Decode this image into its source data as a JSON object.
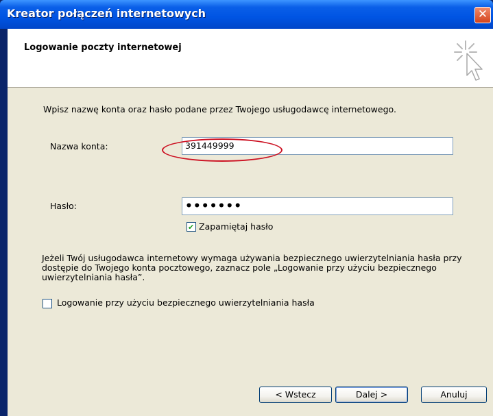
{
  "window": {
    "title": "Kreator połączeń internetowych",
    "close_glyph": "✕"
  },
  "header": {
    "title": "Logowanie poczty internetowej",
    "icon": "wizard-cursor-icon"
  },
  "form": {
    "intro": "Wpisz nazwę konta oraz hasło podane przez Twojego usługodawcę internetowego.",
    "account_label": "Nazwa konta:",
    "account_value": "391449999",
    "password_label": "Hasło:",
    "password_mask": "•••••••",
    "remember_label": "Zapamiętaj hasło",
    "remember_checked": true,
    "spa_paragraph": "Jeżeli Twój usługodawca internetowy wymaga używania bezpiecznego uwierzytelniania hasła przy dostępie do Twojego konta pocztowego, zaznacz pole „Logowanie przy użyciu bezpiecznego uwierzytelniania hasła”.",
    "spa_label": "Logowanie przy użyciu bezpiecznego uwierzytelniania hasła",
    "spa_checked": false
  },
  "annotation": {
    "color": "#cc1122"
  },
  "buttons": {
    "back": "< Wstecz",
    "next": "Dalej >",
    "cancel": "Anuluj"
  },
  "colors": {
    "titlebar": "#0054e3",
    "dialog_bg": "#ece9d8",
    "window_border": "#0a246a"
  }
}
